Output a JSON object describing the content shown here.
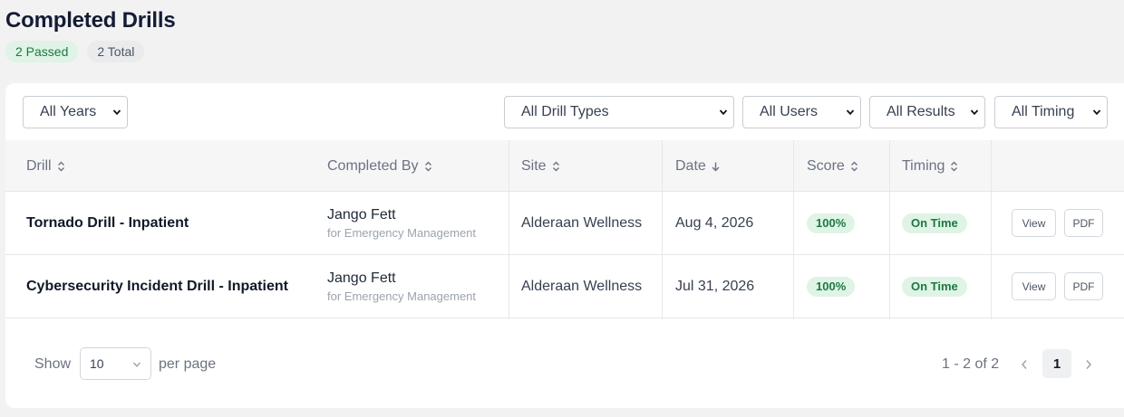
{
  "page": {
    "title": "Completed Drills",
    "badges": {
      "passed": "2 Passed",
      "total": "2 Total"
    }
  },
  "filters": {
    "years": "All Years",
    "drill_types": "All Drill Types",
    "users": "All Users",
    "results": "All Results",
    "timing": "All Timing"
  },
  "table": {
    "columns": [
      "Drill",
      "Completed By",
      "Site",
      "Date",
      "Score",
      "Timing"
    ],
    "rows": [
      {
        "drill": "Tornado Drill - Inpatient",
        "completed_by": "Jango Fett",
        "completed_for": "for Emergency Management",
        "site": "Alderaan Wellness",
        "date": "Aug 4, 2026",
        "score": "100%",
        "timing": "On Time",
        "view_label": "View",
        "pdf_label": "PDF"
      },
      {
        "drill": "Cybersecurity Incident Drill - Inpatient",
        "completed_by": "Jango Fett",
        "completed_for": "for Emergency Management",
        "site": "Alderaan Wellness",
        "date": "Jul 31, 2026",
        "score": "100%",
        "timing": "On Time",
        "view_label": "View",
        "pdf_label": "PDF"
      }
    ]
  },
  "pagination": {
    "show_label": "Show",
    "per_page_value": "10",
    "per_page_label": "per page",
    "range": "1 - 2 of 2",
    "current_page": "1"
  },
  "colors": {
    "success_bg": "#dff3e6",
    "success_text": "#1b7a3f",
    "page_bg": "#f2f2f3"
  }
}
